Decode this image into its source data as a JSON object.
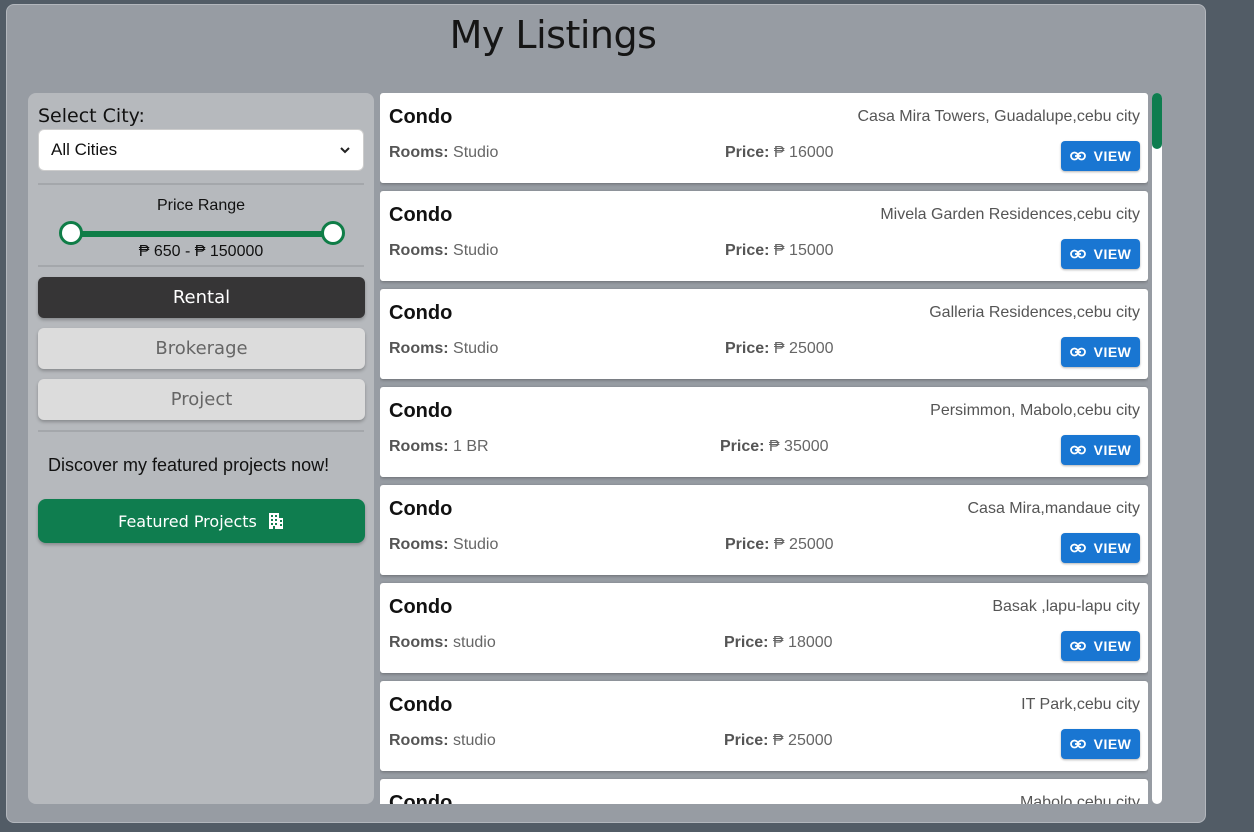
{
  "page_title": "My Listings",
  "sidebar": {
    "city_label": "Select City:",
    "city_selected": "All Cities",
    "price_range_label": "Price Range",
    "price_range_value": "₱ 650 - ₱ 150000",
    "price_min": 650,
    "price_max": 150000,
    "tabs": [
      {
        "label": "Rental",
        "active": true
      },
      {
        "label": "Brokerage",
        "active": false
      },
      {
        "label": "Project",
        "active": false
      }
    ],
    "discover_text": "Discover my featured projects now!",
    "featured_button": "Featured Projects"
  },
  "common": {
    "rooms_label": "Rooms:",
    "price_label": "Price:",
    "view_label": "VIEW"
  },
  "listings": [
    {
      "type": "Condo",
      "location": "Casa Mira Towers, Guadalupe,cebu city",
      "rooms": "Studio",
      "price": "₱ 16000"
    },
    {
      "type": "Condo",
      "location": "Mivela Garden Residences,cebu city",
      "rooms": "Studio",
      "price": "₱ 15000"
    },
    {
      "type": "Condo",
      "location": "Galleria Residences,cebu city",
      "rooms": "Studio",
      "price": "₱ 25000"
    },
    {
      "type": "Condo",
      "location": "Persimmon, Mabolo,cebu city",
      "rooms": "1 BR",
      "price": "₱ 35000"
    },
    {
      "type": "Condo",
      "location": "Casa Mira,mandaue city",
      "rooms": "Studio",
      "price": "₱ 25000"
    },
    {
      "type": "Condo",
      "location": "Basak ,lapu-lapu city",
      "rooms": "studio",
      "price": "₱ 18000"
    },
    {
      "type": "Condo",
      "location": "IT Park,cebu city",
      "rooms": "studio",
      "price": "₱ 25000"
    },
    {
      "type": "Condo",
      "location": "Mabolo,cebu city",
      "rooms": "",
      "price": ""
    }
  ],
  "colors": {
    "accent_green": "#0f7d4f",
    "view_blue": "#1976d2",
    "active_tab": "#363536"
  }
}
